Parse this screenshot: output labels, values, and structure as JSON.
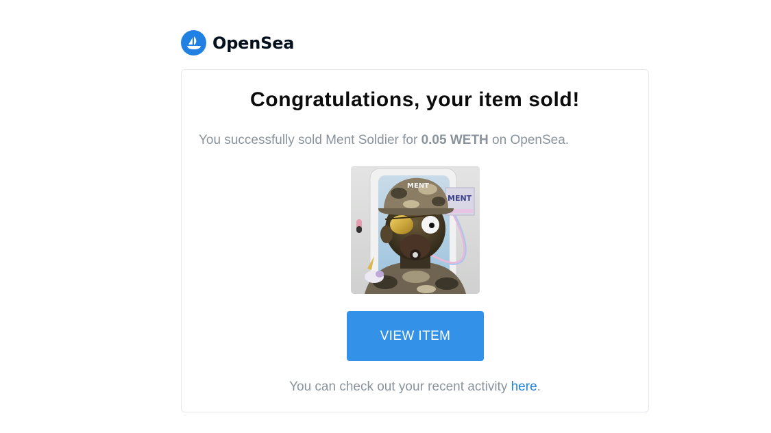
{
  "brand": {
    "name": "OpenSea",
    "logo_icon": "opensea-ship-icon",
    "color": "#2081e2"
  },
  "email": {
    "headline": "Congratulations, your item sold!",
    "message": {
      "prefix": "You successfully sold Ment Soldier for ",
      "price": "0.05 WETH",
      "suffix": " on OpenSea."
    },
    "item_image": {
      "alt": "Ment Soldier",
      "icon": "nft-artwork-soldier"
    },
    "cta_label": "VIEW ITEM",
    "cta_color": "#3391e8",
    "footer": {
      "prefix": "You can check out your recent activity ",
      "link_text": "here",
      "suffix": "."
    }
  }
}
